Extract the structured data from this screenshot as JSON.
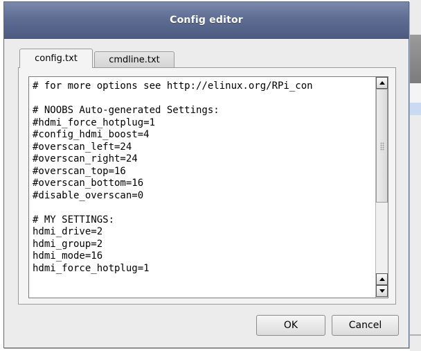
{
  "dialog": {
    "title": "Config editor",
    "tabs": [
      {
        "label": "config.txt",
        "active": true
      },
      {
        "label": "cmdline.txt",
        "active": false
      }
    ],
    "editor": {
      "lines": [
        "# for more options see http://elinux.org/RPi_con",
        "",
        "# NOOBS Auto-generated Settings:",
        "#hdmi_force_hotplug=1",
        "#config_hdmi_boost=4",
        "#overscan_left=24",
        "#overscan_right=24",
        "#overscan_top=16",
        "#overscan_bottom=16",
        "#disable_overscan=0",
        "",
        "# MY SETTINGS:",
        "hdmi_drive=2",
        "hdmi_group=2",
        "hdmi_mode=16",
        "hdmi_force_hotplug=1"
      ]
    },
    "buttons": {
      "ok_label": "OK",
      "cancel_label": "Cancel"
    }
  },
  "colors": {
    "titlebar": "#5f6d93",
    "dialog_bg": "#ececec"
  },
  "icons": {
    "scroll_up": "arrow-up-icon",
    "scroll_down": "arrow-down-icon"
  }
}
